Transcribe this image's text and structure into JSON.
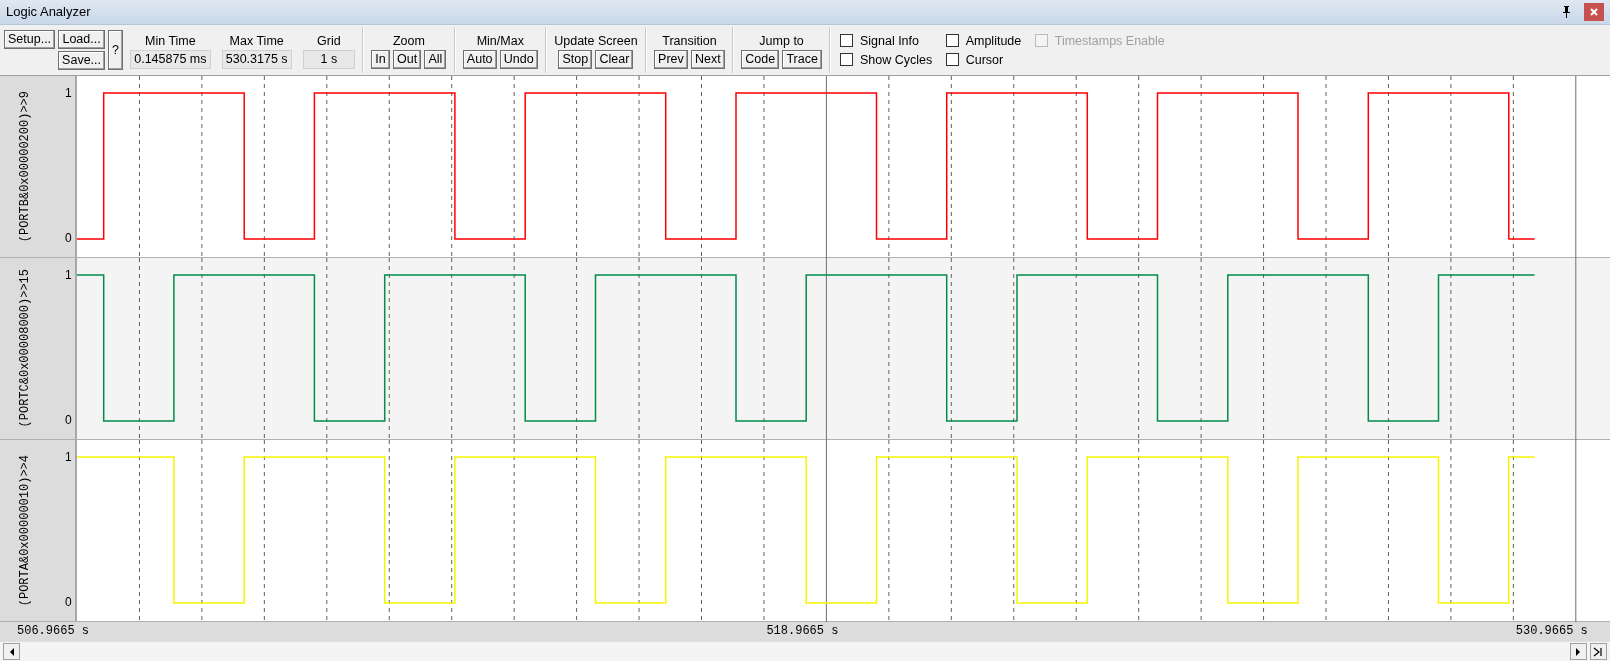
{
  "window": {
    "title": "Logic Analyzer"
  },
  "toolbar": {
    "file_buttons": [
      {
        "label": "Setup..."
      },
      {
        "label": "Load..."
      },
      {
        "label": "Save..."
      }
    ],
    "help_button": "?",
    "readouts": [
      {
        "label": "Min Time",
        "value": "0.145875 ms"
      },
      {
        "label": "Max Time",
        "value": "530.3175 s"
      },
      {
        "label": "Grid",
        "value": "1 s"
      }
    ],
    "button_groups": [
      {
        "title": "Zoom",
        "buttons": [
          "In",
          "Out",
          "All"
        ]
      },
      {
        "title": "Min/Max",
        "buttons": [
          "Auto",
          "Undo"
        ]
      },
      {
        "title": "Update Screen",
        "buttons": [
          "Stop",
          "Clear"
        ]
      },
      {
        "title": "Transition",
        "buttons": [
          "Prev",
          "Next"
        ]
      },
      {
        "title": "Jump to",
        "buttons": [
          "Code",
          "Trace"
        ]
      }
    ],
    "checkboxes": [
      {
        "label": "Signal Info",
        "checked": false,
        "disabled": false
      },
      {
        "label": "Amplitude",
        "checked": false,
        "disabled": false
      },
      {
        "label": "Timestamps Enable",
        "checked": false,
        "disabled": true
      },
      {
        "label": "Show Cycles",
        "checked": false,
        "disabled": false
      },
      {
        "label": "Cursor",
        "checked": false,
        "disabled": false
      }
    ]
  },
  "signals": [
    {
      "name": "(PORTB&0x00000200)>>9",
      "high_label": "1",
      "low_label": "0",
      "color": "#ff0000"
    },
    {
      "name": "(PORTC&0x00008000)>>15",
      "high_label": "1",
      "low_label": "0",
      "color": "#008c4a"
    },
    {
      "name": "(PORTA&0x00000010)>>4",
      "high_label": "1",
      "low_label": "0",
      "color": "#f5f500"
    }
  ],
  "time_axis": {
    "labels": [
      "506.9665 s",
      "518.9665 s",
      "530.9665 s"
    ]
  }
}
